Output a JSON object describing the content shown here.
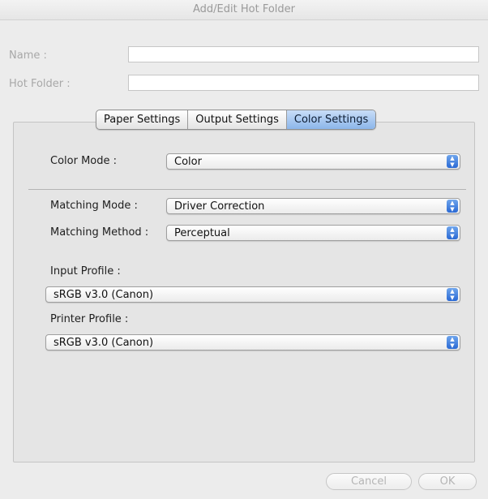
{
  "window": {
    "title": "Add/Edit Hot Folder"
  },
  "form": {
    "name_label": "Name :",
    "name_value": "",
    "hot_folder_label": "Hot Folder :",
    "hot_folder_value": ""
  },
  "tabs": [
    {
      "label": "Paper Settings",
      "active": false
    },
    {
      "label": "Output Settings",
      "active": false
    },
    {
      "label": "Color Settings",
      "active": true
    }
  ],
  "color_settings": {
    "color_mode_label": "Color Mode :",
    "color_mode_value": "Color",
    "matching_mode_label": "Matching Mode :",
    "matching_mode_value": "Driver Correction",
    "matching_method_label": "Matching Method :",
    "matching_method_value": "Perceptual",
    "input_profile_label": "Input Profile :",
    "input_profile_value": "sRGB v3.0 (Canon)",
    "printer_profile_label": "Printer Profile :",
    "printer_profile_value": "sRGB v3.0 (Canon)"
  },
  "buttons": {
    "cancel": "Cancel",
    "ok": "OK"
  },
  "colors": {
    "accent": "#3b7be0",
    "tab_active": "#a9c9f1"
  }
}
